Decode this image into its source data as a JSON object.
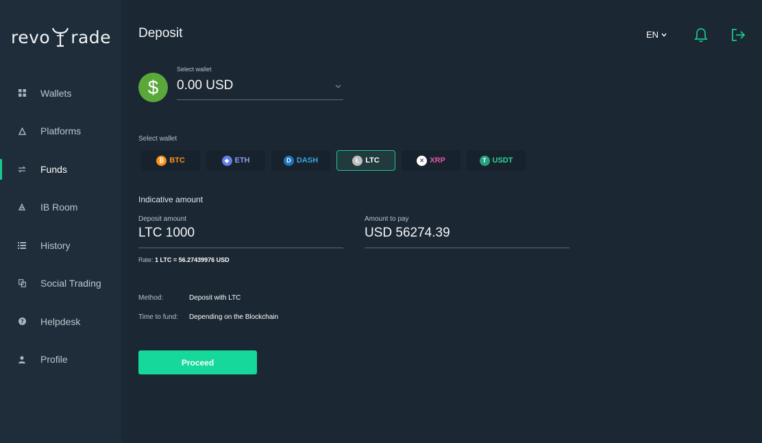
{
  "brand": {
    "logo_prefix": "revo",
    "logo_suffix": "rade"
  },
  "sidebar": {
    "items": [
      {
        "label": "Wallets",
        "icon": "grid-icon",
        "active": false
      },
      {
        "label": "Platforms",
        "icon": "triangle-icon",
        "active": false
      },
      {
        "label": "Funds",
        "icon": "transfer-icon",
        "active": true
      },
      {
        "label": "IB Room",
        "icon": "ib-icon",
        "active": false
      },
      {
        "label": "History",
        "icon": "list-icon",
        "active": false
      },
      {
        "label": "Social Trading",
        "icon": "copy-icon",
        "active": false
      },
      {
        "label": "Helpdesk",
        "icon": "help-icon",
        "active": false
      },
      {
        "label": "Profile",
        "icon": "user-icon",
        "active": false
      }
    ]
  },
  "header": {
    "title": "Deposit",
    "language": "EN",
    "icons": [
      "bell-icon",
      "logout-icon"
    ]
  },
  "wallet": {
    "label": "Select wallet",
    "value": "0.00 USD",
    "icon": "dollar-icon"
  },
  "coins": {
    "label": "Select wallet",
    "items": [
      {
        "symbol": "BTC",
        "glyph": "₿",
        "color": "#f7931a",
        "text_color": "#f7931a",
        "active": false
      },
      {
        "symbol": "ETH",
        "glyph": "◆",
        "color": "#627eea",
        "text_color": "#8aa0f2",
        "active": false
      },
      {
        "symbol": "DASH",
        "glyph": "D",
        "color": "#1c75bc",
        "text_color": "#3fa3e8",
        "active": false
      },
      {
        "symbol": "LTC",
        "glyph": "Ł",
        "color": "#bebebe",
        "text_color": "#ffffff",
        "active": true
      },
      {
        "symbol": "XRP",
        "glyph": "✕",
        "color": "#ffffff",
        "text_color": "#e05aa8",
        "active": false
      },
      {
        "symbol": "USDT",
        "glyph": "T",
        "color": "#26a17b",
        "text_color": "#2fd39a",
        "active": false
      }
    ]
  },
  "amount": {
    "title": "Indicative amount",
    "deposit_label": "Deposit amount",
    "deposit_value": "LTC 1000",
    "pay_label": "Amount to pay",
    "pay_value": "USD 56274.39",
    "rate_prefix": "Rate:",
    "rate_value": "1 LTC = 56.27439976 USD"
  },
  "details": {
    "method_label": "Method:",
    "method_value": "Deposit with LTC",
    "time_label": "Time to fund:",
    "time_value": "Depending on the Blockchain"
  },
  "actions": {
    "proceed_label": "Proceed"
  },
  "colors": {
    "accent": "#16d89a",
    "background": "#1b2733",
    "sidebar": "#1f2d3a"
  }
}
